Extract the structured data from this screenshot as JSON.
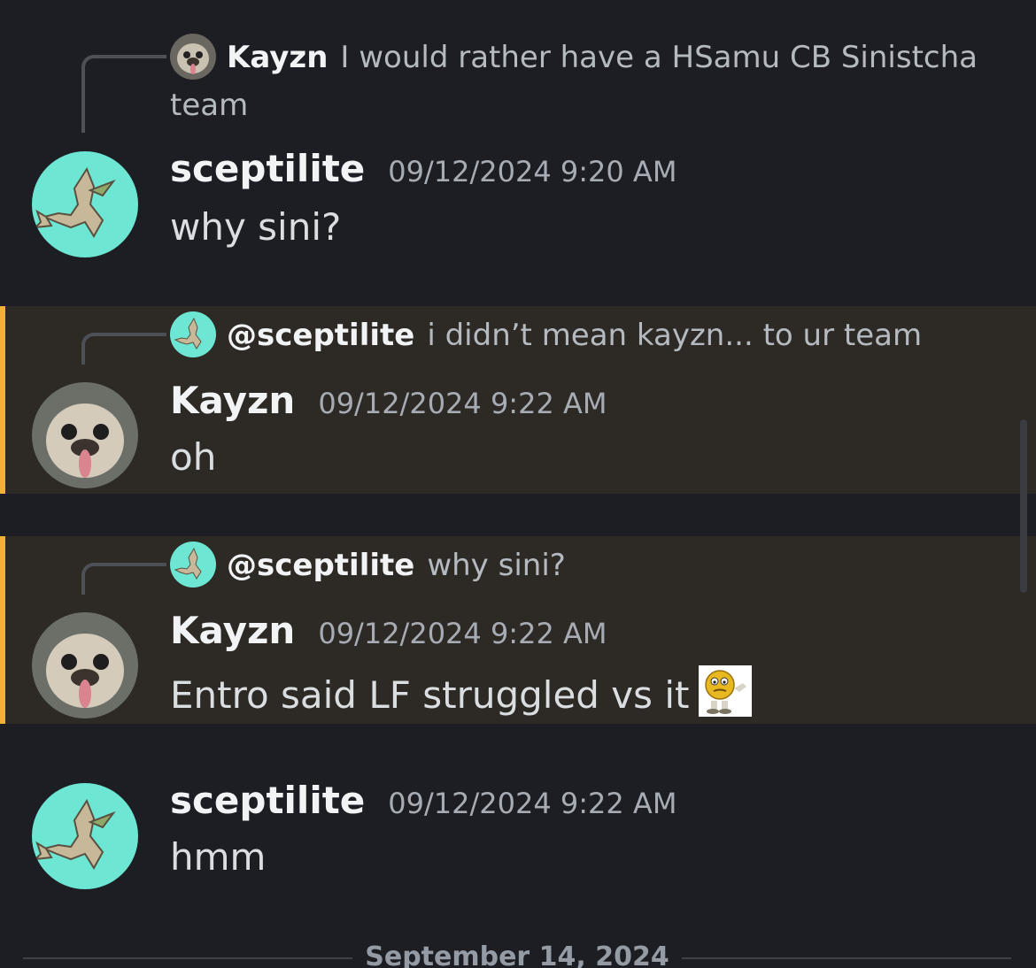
{
  "messages": [
    {
      "reply": {
        "author": "Kayzn",
        "text": "I would rather have a HSamu CB Sinistcha team"
      },
      "author": "sceptilite",
      "timestamp": "09/12/2024 9:20 AM",
      "content": "why sini?",
      "highlighted": false
    },
    {
      "reply": {
        "author": "@sceptilite",
        "text": "i didn’t mean kayzn... to ur team"
      },
      "author": "Kayzn",
      "timestamp": "09/12/2024 9:22 AM",
      "content": "oh",
      "highlighted": true
    },
    {
      "reply": {
        "author": "@sceptilite",
        "text": "why sini?"
      },
      "author": "Kayzn",
      "timestamp": "09/12/2024 9:22 AM",
      "content": "Entro said LF struggled vs it",
      "highlighted": true
    },
    {
      "author": "sceptilite",
      "timestamp": "09/12/2024 9:22 AM",
      "content": "hmm",
      "highlighted": false
    }
  ],
  "date_divider": "September 14, 2024",
  "colors": {
    "background": "#1d1e23",
    "highlight_bg": "#2d2a26",
    "highlight_border": "#f0b232",
    "avatar_sceptilite": "#6ee6d4"
  }
}
